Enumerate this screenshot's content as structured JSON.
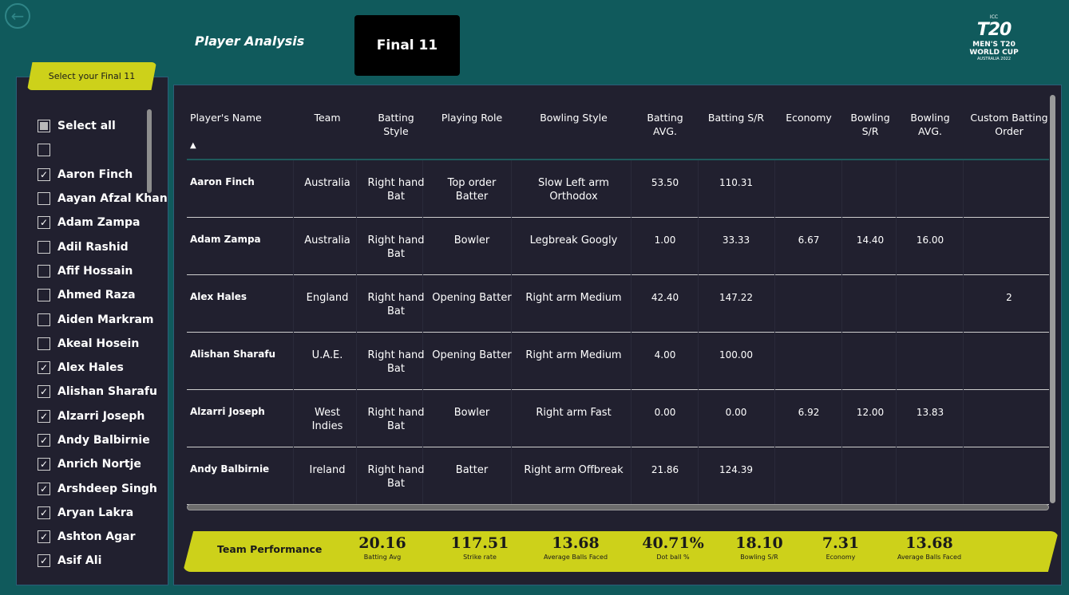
{
  "header": {
    "back_icon": "arrow-left-circle-icon",
    "page_title": "Player Analysis",
    "final_button": "Final 11",
    "logo": {
      "top": "ICC",
      "mark": "T20",
      "line1": "MEN'S T20",
      "line2": "WORLD CUP",
      "line3": "AUSTRALIA 2022"
    }
  },
  "slicer": {
    "title": "Select your Final 11",
    "items": [
      {
        "label": "Select all",
        "state": "partial"
      },
      {
        "label": "",
        "state": "unchecked"
      },
      {
        "label": "Aaron Finch",
        "state": "checked"
      },
      {
        "label": "Aayan Afzal Khan",
        "state": "unchecked"
      },
      {
        "label": "Adam Zampa",
        "state": "checked"
      },
      {
        "label": "Adil Rashid",
        "state": "unchecked"
      },
      {
        "label": "Afif Hossain",
        "state": "unchecked"
      },
      {
        "label": "Ahmed Raza",
        "state": "unchecked"
      },
      {
        "label": "Aiden Markram",
        "state": "unchecked"
      },
      {
        "label": "Akeal Hosein",
        "state": "unchecked"
      },
      {
        "label": "Alex Hales",
        "state": "checked"
      },
      {
        "label": "Alishan Sharafu",
        "state": "checked"
      },
      {
        "label": "Alzarri Joseph",
        "state": "checked"
      },
      {
        "label": "Andy Balbirnie",
        "state": "checked"
      },
      {
        "label": "Anrich Nortje",
        "state": "checked"
      },
      {
        "label": "Arshdeep Singh",
        "state": "checked"
      },
      {
        "label": "Aryan Lakra",
        "state": "checked"
      },
      {
        "label": "Ashton Agar",
        "state": "checked"
      },
      {
        "label": "Asif Ali",
        "state": "checked"
      }
    ]
  },
  "table": {
    "columns": [
      "Player's Name",
      "Team",
      "Batting Style",
      "Playing Role",
      "Bowling Style",
      "Batting AVG.",
      "Batting S/R",
      "Economy",
      "Bowling S/R",
      "Bowling AVG.",
      "Custom Batting Order"
    ],
    "rows": [
      {
        "name": "Aaron Finch",
        "team": "Australia",
        "bat_style": "Right hand Bat",
        "role": "Top order Batter",
        "bowl_style": "Slow Left arm Orthodox",
        "bat_avg": "53.50",
        "bat_sr": "110.31",
        "economy": "",
        "bowl_sr": "",
        "bowl_avg": "",
        "order": ""
      },
      {
        "name": "Adam Zampa",
        "team": "Australia",
        "bat_style": "Right hand Bat",
        "role": "Bowler",
        "bowl_style": "Legbreak Googly",
        "bat_avg": "1.00",
        "bat_sr": "33.33",
        "economy": "6.67",
        "bowl_sr": "14.40",
        "bowl_avg": "16.00",
        "order": ""
      },
      {
        "name": "Alex Hales",
        "team": "England",
        "bat_style": "Right hand Bat",
        "role": "Opening Batter",
        "bowl_style": "Right arm Medium",
        "bat_avg": "42.40",
        "bat_sr": "147.22",
        "economy": "",
        "bowl_sr": "",
        "bowl_avg": "",
        "order": "2"
      },
      {
        "name": "Alishan Sharafu",
        "team": "U.A.E.",
        "bat_style": "Right hand Bat",
        "role": "Opening Batter",
        "bowl_style": "Right arm Medium",
        "bat_avg": "4.00",
        "bat_sr": "100.00",
        "economy": "",
        "bowl_sr": "",
        "bowl_avg": "",
        "order": ""
      },
      {
        "name": "Alzarri Joseph",
        "team": "West Indies",
        "bat_style": "Right hand Bat",
        "role": "Bowler",
        "bowl_style": "Right arm Fast",
        "bat_avg": "0.00",
        "bat_sr": "0.00",
        "economy": "6.92",
        "bowl_sr": "12.00",
        "bowl_avg": "13.83",
        "order": ""
      },
      {
        "name": "Andy Balbirnie",
        "team": "Ireland",
        "bat_style": "Right hand Bat",
        "role": "Batter",
        "bowl_style": "Right arm Offbreak",
        "bat_avg": "21.86",
        "bat_sr": "124.39",
        "economy": "",
        "bowl_sr": "",
        "bowl_avg": "",
        "order": ""
      }
    ]
  },
  "performance": {
    "title": "Team Performance",
    "kpis": [
      {
        "value": "20.16",
        "label": "Batting Avg"
      },
      {
        "value": "117.51",
        "label": "Strike rate"
      },
      {
        "value": "13.68",
        "label": "Average Balls Faced"
      },
      {
        "value": "40.71%",
        "label": "Dot ball %"
      },
      {
        "value": "18.10",
        "label": "Bowling S/R"
      },
      {
        "value": "7.31",
        "label": "Economy"
      },
      {
        "value": "13.68",
        "label": "Average Balls Faced"
      }
    ]
  },
  "colors": {
    "background": "#105a5c",
    "panel": "#21202f",
    "accent": "#cdd11a"
  }
}
